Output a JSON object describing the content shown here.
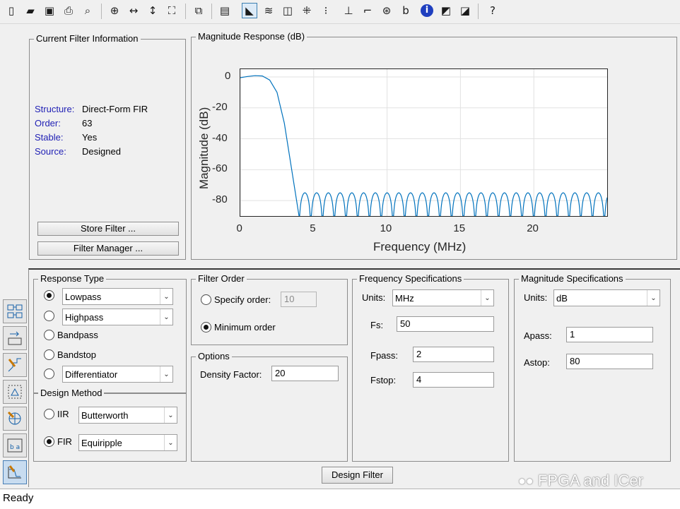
{
  "toolbar": {
    "buttons": [
      {
        "name": "new-icon",
        "glyph": "▯"
      },
      {
        "name": "open-icon",
        "glyph": "▰"
      },
      {
        "name": "save-icon",
        "glyph": "▣"
      },
      {
        "name": "print-icon",
        "glyph": "⎙"
      },
      {
        "name": "print-preview-icon",
        "glyph": "⌕"
      },
      {
        "name": "zoom-in-icon",
        "glyph": "⊕"
      },
      {
        "name": "zoom-x-icon",
        "glyph": "↔"
      },
      {
        "name": "zoom-y-icon",
        "glyph": "↕"
      },
      {
        "name": "full-view-icon",
        "glyph": "⛶"
      },
      {
        "name": "new-figure-icon",
        "glyph": "⧉"
      },
      {
        "name": "filter-specs-icon",
        "glyph": "▤"
      },
      {
        "name": "magnitude-response-icon",
        "glyph": "◣"
      },
      {
        "name": "phase-response-icon",
        "glyph": "≋"
      },
      {
        "name": "magnitude-phase-icon",
        "glyph": "◫"
      },
      {
        "name": "group-delay-icon",
        "glyph": "⁜"
      },
      {
        "name": "phase-delay-icon",
        "glyph": "⁝"
      },
      {
        "name": "impulse-response-icon",
        "glyph": "⊥"
      },
      {
        "name": "step-response-icon",
        "glyph": "⌐"
      },
      {
        "name": "pole-zero-icon",
        "glyph": "⊛"
      },
      {
        "name": "filter-coefficients-icon",
        "glyph": "b"
      },
      {
        "name": "filter-information-icon",
        "glyph": "ℹ"
      },
      {
        "name": "magnitude-estimate-icon",
        "glyph": "◩"
      },
      {
        "name": "noise-power-icon",
        "glyph": "◪"
      },
      {
        "name": "whats-this-icon",
        "glyph": "?"
      }
    ]
  },
  "current_filter": {
    "title": "Current Filter Information",
    "rows": [
      {
        "key": "Structure:",
        "value": "Direct-Form FIR"
      },
      {
        "key": "Order:",
        "value": "63"
      },
      {
        "key": "Stable:",
        "value": "Yes"
      },
      {
        "key": "Source:",
        "value": "Designed"
      }
    ],
    "store_filter_label": "Store Filter ...",
    "filter_manager_label": "Filter Manager ..."
  },
  "plot": {
    "title": "Magnitude Response (dB)",
    "chart_data": {
      "type": "line",
      "xlabel": "Frequency (MHz)",
      "ylabel": "Magnitude (dB)",
      "xlim": [
        0,
        25
      ],
      "ylim": [
        -90,
        5
      ],
      "xticks": [
        0,
        5,
        10,
        15,
        20
      ],
      "yticks": [
        0,
        -20,
        -40,
        -60,
        -80
      ],
      "grid": true,
      "series": [
        {
          "color": "#0072bd",
          "passband": {
            "x": [
              0,
              0.5,
              1.0,
              1.5,
              2.0,
              2.5,
              3.0,
              3.5,
              4.0
            ],
            "y": [
              -0.5,
              0.3,
              0.8,
              0.6,
              -2,
              -10,
              -30,
              -60,
              -90
            ]
          },
          "stopband": {
            "start": 4.0,
            "end": 25,
            "lobe_width": 0.8,
            "peak": -75,
            "floor": -90
          }
        }
      ]
    }
  },
  "response_type": {
    "title": "Response Type",
    "options": [
      {
        "label": "Lowpass",
        "selected": true,
        "has_dropdown": true
      },
      {
        "label": "Highpass",
        "selected": false,
        "has_dropdown": true
      },
      {
        "label": "Bandpass",
        "selected": false,
        "has_dropdown": false
      },
      {
        "label": "Bandstop",
        "selected": false,
        "has_dropdown": false
      },
      {
        "label": "Differentiator",
        "selected": false,
        "has_dropdown": true
      }
    ]
  },
  "design_method": {
    "title": "Design Method",
    "iir_label": "IIR",
    "iir_value": "Butterworth",
    "iir_selected": false,
    "fir_label": "FIR",
    "fir_value": "Equiripple",
    "fir_selected": true
  },
  "filter_order": {
    "title": "Filter Order",
    "specify_label": "Specify order:",
    "specify_value": "10",
    "specify_selected": false,
    "minimum_label": "Minimum order",
    "minimum_selected": true
  },
  "options": {
    "title": "Options",
    "density_label": "Density Factor:",
    "density_value": "20"
  },
  "freq_specs": {
    "title": "Frequency Specifications",
    "units_label": "Units:",
    "units_value": "MHz",
    "fs_label": "Fs:",
    "fs_value": "50",
    "fpass_label": "Fpass:",
    "fpass_value": "2",
    "fstop_label": "Fstop:",
    "fstop_value": "4"
  },
  "mag_specs": {
    "title": "Magnitude Specifications",
    "units_label": "Units:",
    "units_value": "dB",
    "apass_label": "Apass:",
    "apass_value": "1",
    "astop_label": "Astop:",
    "astop_value": "80"
  },
  "design_filter_label": "Design Filter",
  "watermark": "FPGA and ICer",
  "status": "Ready",
  "colors": {
    "key_text": "#2121b5",
    "plot_line": "#0072bd",
    "active_icon_bg": "#dceaf7"
  }
}
